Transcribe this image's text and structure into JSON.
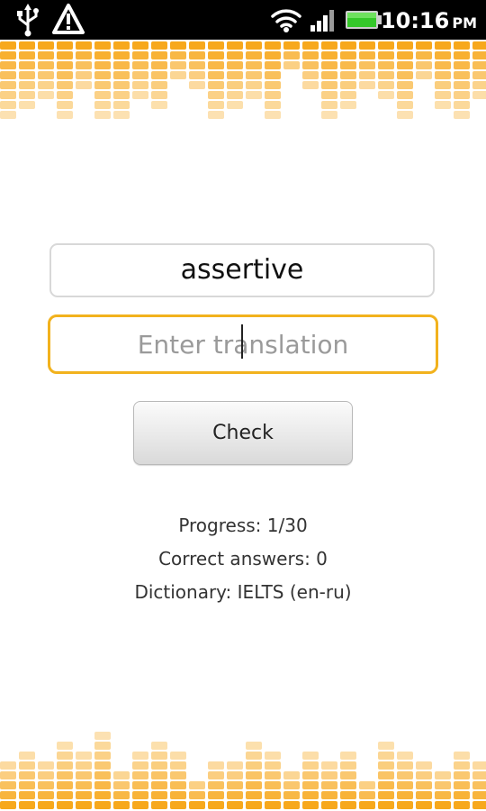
{
  "status_bar": {
    "time": "10:16",
    "ampm": "PM",
    "icons": [
      "usb-icon",
      "warning-icon",
      "wifi-icon",
      "signal-icon",
      "battery-icon"
    ]
  },
  "quiz": {
    "word": "assertive",
    "translation_placeholder": "Enter translation",
    "translation_value": "",
    "check_label": "Check",
    "progress": "Progress: 1/30",
    "correct_answers": "Correct answers: 0",
    "dictionary": "Dictionary: IELTS (en-ru)"
  },
  "theme": {
    "accent": "#f2b21d",
    "eq_color": "#f7a81c",
    "status_bar_bg": "#000000",
    "battery_green": "#35c82a"
  }
}
